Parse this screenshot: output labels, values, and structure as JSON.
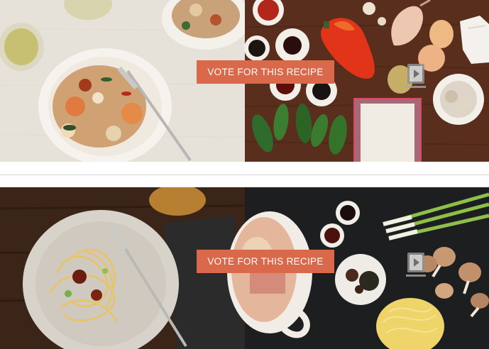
{
  "recipes": [
    {
      "vote_label": "VOTE FOR THIS RECIPE",
      "dish": "shrimp noodle stir-fry",
      "media_icon": "video-icon"
    },
    {
      "vote_label": "VOTE FOR THIS RECIPE",
      "dish": "noodle dish with ingredients",
      "media_icon": "video-icon"
    }
  ],
  "colors": {
    "vote_button_bg": "#d9694a",
    "linen_bg": "#e7e3dc",
    "wood_bg": "#5b2f1d",
    "dark_wood_bg": "#3a2216",
    "slate_bg": "#1c1d1f",
    "gap_bg": "#ffffff"
  }
}
